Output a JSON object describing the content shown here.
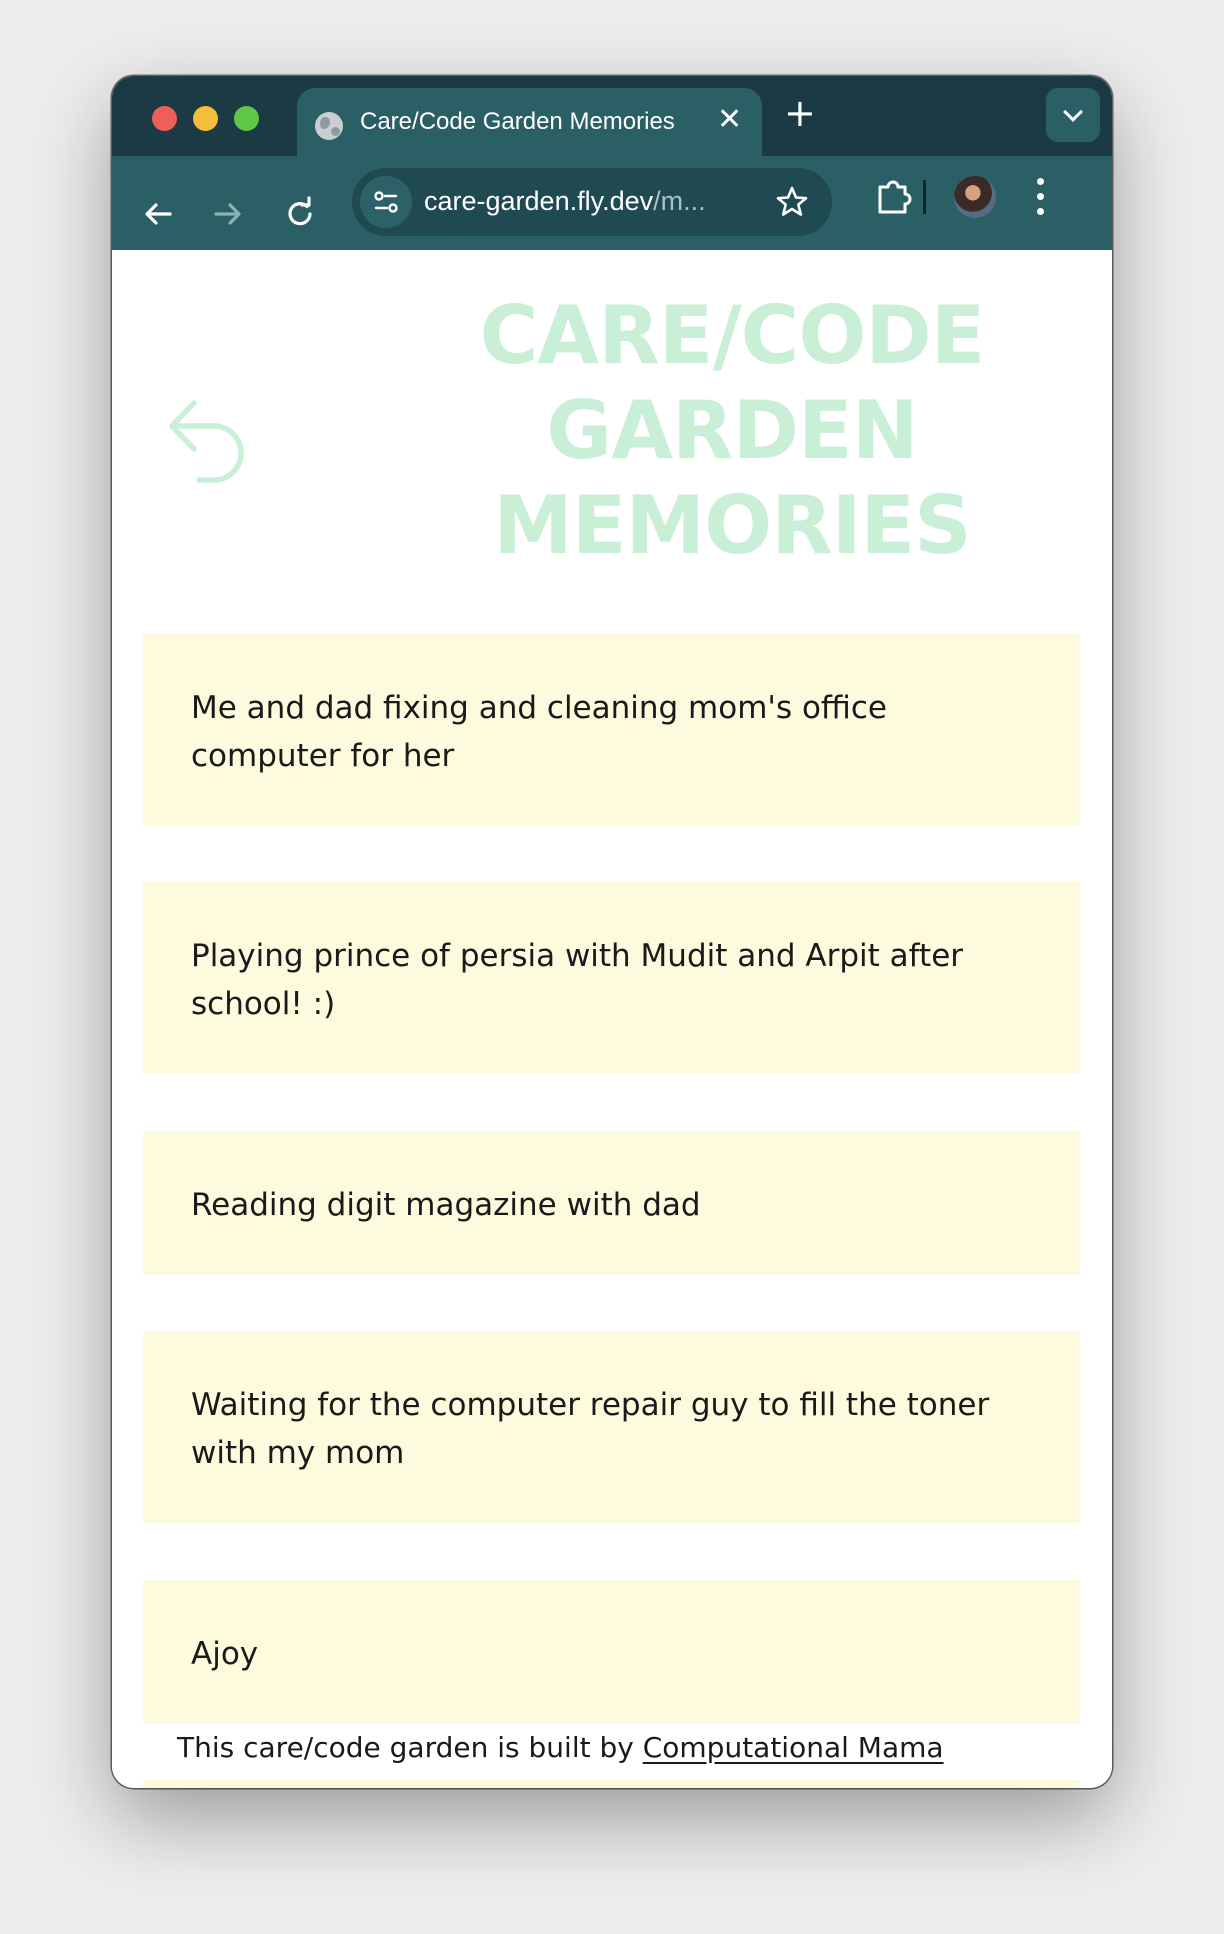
{
  "browser": {
    "tab_title": "Care/Code Garden Memories",
    "url_main": "care-garden.fly.dev",
    "url_rest": "/m...",
    "tab_close": "✕",
    "new_tab": "+"
  },
  "page": {
    "title": "CARE/CODE GARDEN MEMORIES",
    "accent_color": "#c9f0d6",
    "card_color": "#fdfadd"
  },
  "memories": [
    "Me and dad fixing and cleaning mom's office computer for her",
    "Playing prince of persia with Mudit and Arpit after school! :)",
    "Reading digit magazine with dad",
    "Waiting for the computer repair guy to fill the toner with my mom",
    "Ajoy"
  ],
  "footer": {
    "text": "This care/code garden is built by ",
    "link_label": "Computational Mama"
  }
}
